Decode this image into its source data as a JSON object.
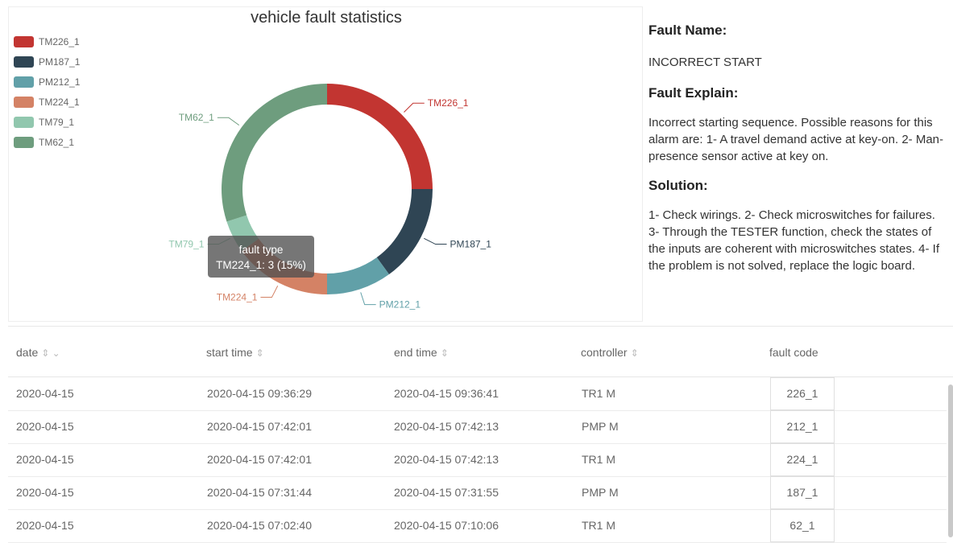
{
  "chart_data": {
    "type": "pie",
    "title": "vehicle fault statistics",
    "donut": true,
    "series_name": "fault type",
    "categories": [
      "TM226_1",
      "PM187_1",
      "PM212_1",
      "TM224_1",
      "TM79_1",
      "TM62_1"
    ],
    "values": [
      5,
      3,
      2,
      3,
      1,
      6
    ],
    "colors": [
      "#c23531",
      "#2f4554",
      "#61a0a8",
      "#d48265",
      "#91c7ae",
      "#6e9d7e"
    ],
    "legend_position": "top-left",
    "tooltip": {
      "title": "fault type",
      "text": "TM224_1: 3 (15%)"
    }
  },
  "fault_info": {
    "name_heading": "Fault Name:",
    "name_value": "INCORRECT START",
    "explain_heading": "Fault Explain:",
    "explain_text": "Incorrect starting sequence. Possible reasons for this alarm are: 1- A travel demand active at key-on. 2- Man-presence sensor active at key on.",
    "solution_heading": "Solution:",
    "solution_text": "1- Check wirings. 2- Check microswitches for failures. 3- Through the TESTER function, check the states of the inputs are coherent with microswitches states. 4- If the problem is not solved, replace the logic board."
  },
  "table": {
    "columns": [
      "date",
      "start time",
      "end time",
      "controller",
      "fault code"
    ],
    "rows": [
      {
        "date": "2020-04-15",
        "start": "2020-04-15 09:36:29",
        "end": "2020-04-15 09:36:41",
        "controller": "TR1 M",
        "code": "226_1"
      },
      {
        "date": "2020-04-15",
        "start": "2020-04-15 07:42:01",
        "end": "2020-04-15 07:42:13",
        "controller": "PMP M",
        "code": "212_1"
      },
      {
        "date": "2020-04-15",
        "start": "2020-04-15 07:42:01",
        "end": "2020-04-15 07:42:13",
        "controller": "TR1 M",
        "code": "224_1"
      },
      {
        "date": "2020-04-15",
        "start": "2020-04-15 07:31:44",
        "end": "2020-04-15 07:31:55",
        "controller": "PMP M",
        "code": "187_1"
      },
      {
        "date": "2020-04-15",
        "start": "2020-04-15 07:02:40",
        "end": "2020-04-15 07:10:06",
        "controller": "TR1 M",
        "code": "62_1"
      }
    ]
  }
}
